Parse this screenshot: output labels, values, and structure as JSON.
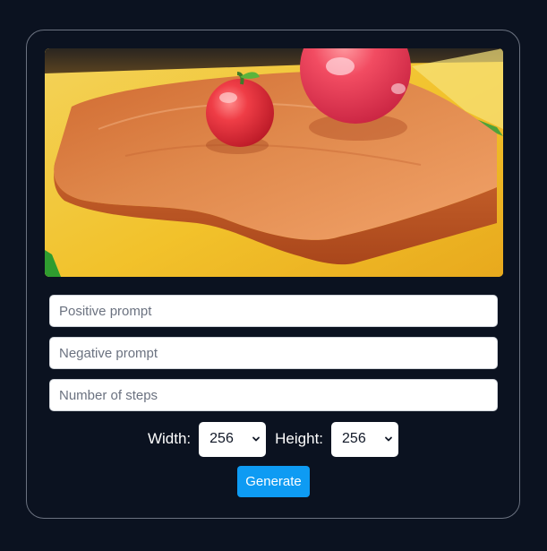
{
  "generated_image": {
    "subject": "two red apples on a wooden cutting board on a yellow table"
  },
  "inputs": {
    "positive_prompt_placeholder": "Positive prompt",
    "negative_prompt_placeholder": "Negative prompt",
    "steps_placeholder": "Number of steps",
    "positive_prompt_value": "",
    "negative_prompt_value": "",
    "steps_value": ""
  },
  "size": {
    "width_label": "Width:",
    "width_value": "256",
    "height_label": "Height:",
    "height_value": "256"
  },
  "actions": {
    "generate_label": "Generate"
  },
  "colors": {
    "background": "#0b1220",
    "button": "#0e9bf3"
  },
  "icons": {
    "select_arrow": "chevron-down-icon"
  }
}
